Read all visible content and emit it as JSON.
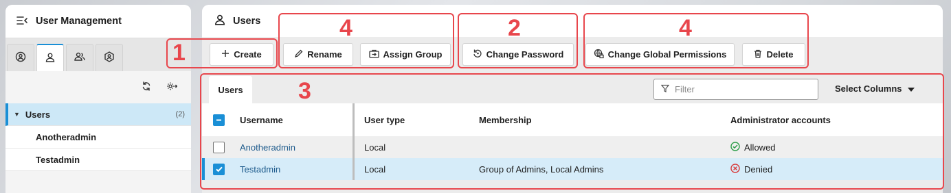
{
  "left_panel": {
    "title": "User Management",
    "tabs": [
      {
        "icon": "user-circle-icon",
        "active": false
      },
      {
        "icon": "user-icon",
        "active": true
      },
      {
        "icon": "users-icon",
        "active": false
      },
      {
        "icon": "user-hexagon-icon",
        "active": false
      }
    ],
    "tree": {
      "group_label": "Users",
      "group_count": "(2)",
      "children": [
        "Anotheradmin",
        "Testadmin"
      ]
    }
  },
  "right_panel": {
    "title": "Users",
    "toolbar": {
      "create": "Create",
      "rename": "Rename",
      "assign_group": "Assign Group",
      "change_password": "Change Password",
      "change_global_permissions": "Change Global Permissions",
      "delete": "Delete"
    },
    "grid": {
      "tab": "Users",
      "filter_placeholder": "Filter",
      "select_columns": "Select Columns",
      "columns": [
        "Username",
        "User type",
        "Membership",
        "Administrator accounts"
      ],
      "rows": [
        {
          "username": "Anotheradmin",
          "user_type": "Local",
          "membership": "",
          "admin": "Allowed",
          "checked": false
        },
        {
          "username": "Testadmin",
          "user_type": "Local",
          "membership": "Group of Admins, Local Admins",
          "admin": "Denied",
          "checked": true
        }
      ]
    }
  },
  "annotations": [
    "1",
    "4",
    "2",
    "4",
    "3"
  ],
  "colors": {
    "accent": "#1a8fd6",
    "annotation": "#e8464c",
    "allowed": "#2e9e49",
    "denied": "#d83b3b",
    "selected_row": "#d6ecf9"
  }
}
